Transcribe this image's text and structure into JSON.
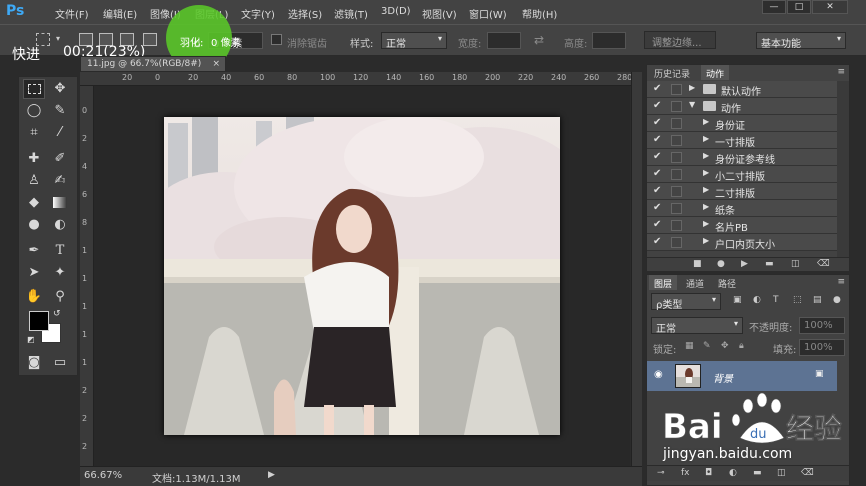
{
  "app": {
    "logo": "Ps"
  },
  "menu": {
    "items": [
      "文件(F)",
      "编辑(E)",
      "图像(I)",
      "图层(L)",
      "文字(Y)",
      "选择(S)",
      "滤镜(T)",
      "3D(D)",
      "视图(V)",
      "窗口(W)",
      "帮助(H)"
    ]
  },
  "window_controls": {
    "minimize": "—",
    "restore": "□",
    "close": "✕"
  },
  "overlay": {
    "quick": "快进",
    "timer": "00:21(23%)"
  },
  "options": {
    "feather_label": "羽化:",
    "feather_value": "0 像素",
    "antialias_label": "消除锯齿",
    "style_label": "样式:",
    "style_value": "正常",
    "width_label": "宽度:",
    "height_label": "高度:",
    "refine_edge_button": "调整边缘...",
    "workspace_value": "基本功能"
  },
  "document": {
    "tab_title": "11.jpg @ 66.7%(RGB/8#)",
    "tab_close": "×",
    "ruler_top_labels": [
      "20",
      "0",
      "20",
      "40",
      "60",
      "80",
      "100",
      "120",
      "140",
      "160",
      "180",
      "200",
      "220",
      "240",
      "260",
      "280"
    ],
    "ruler_left_labels": [
      "0",
      "2",
      "4",
      "6",
      "8",
      "1",
      "1",
      "1",
      "1",
      "1",
      "2",
      "2",
      "2"
    ]
  },
  "status": {
    "zoom": "66.67%",
    "doc_info": "文档:1.13M/1.13M"
  },
  "panels": {
    "top_tabs": [
      "历史记录",
      "动作"
    ],
    "actions": [
      {
        "label": "默认动作",
        "type": "set",
        "open": false
      },
      {
        "label": "动作",
        "type": "set",
        "open": true
      },
      {
        "label": "身份证",
        "type": "action"
      },
      {
        "label": "一寸排版",
        "type": "action"
      },
      {
        "label": "身份证参考线",
        "type": "action"
      },
      {
        "label": "小二寸排版",
        "type": "action"
      },
      {
        "label": "二寸排版",
        "type": "action"
      },
      {
        "label": "纸条",
        "type": "action"
      },
      {
        "label": "名片PB",
        "type": "action"
      },
      {
        "label": "户口内页大小",
        "type": "action"
      }
    ],
    "bottom_tabs": [
      "图层",
      "通道",
      "路径"
    ],
    "layer_kind_filter": "ρ类型",
    "blend_mode": "正常",
    "opacity_label": "不透明度:",
    "opacity_value": "100%",
    "lock_label": "锁定:",
    "fill_label": "填充:",
    "fill_value": "100%",
    "layer_name": "背景"
  },
  "watermark": {
    "url": "jingyan.baidu.com"
  },
  "colors": {
    "accent_green": "#5ac828",
    "ps_blue": "#3ea9f5",
    "selected_layer": "#5d7393"
  }
}
